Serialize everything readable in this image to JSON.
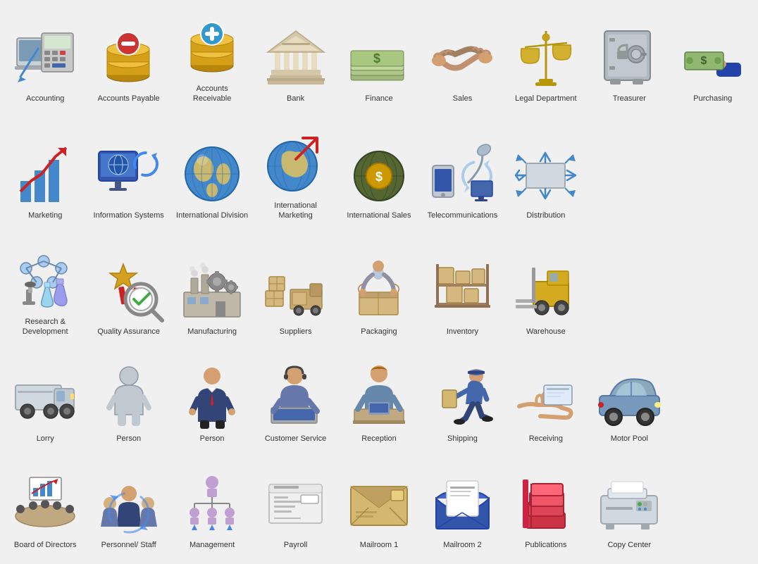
{
  "items": [
    {
      "id": "accounting",
      "label": "Accounting",
      "row": 1,
      "icon": "accounting"
    },
    {
      "id": "accounts-payable",
      "label": "Accounts Payable",
      "row": 1,
      "icon": "accounts-payable"
    },
    {
      "id": "accounts-receivable",
      "label": "Accounts Receivable",
      "row": 1,
      "icon": "accounts-receivable"
    },
    {
      "id": "bank",
      "label": "Bank",
      "row": 1,
      "icon": "bank"
    },
    {
      "id": "finance",
      "label": "Finance",
      "row": 1,
      "icon": "finance"
    },
    {
      "id": "sales",
      "label": "Sales",
      "row": 1,
      "icon": "sales"
    },
    {
      "id": "legal-department",
      "label": "Legal Department",
      "row": 1,
      "icon": "legal"
    },
    {
      "id": "treasurer",
      "label": "Treasurer",
      "row": 1,
      "icon": "treasurer"
    },
    {
      "id": "purchasing",
      "label": "Purchasing",
      "row": 1,
      "icon": "purchasing"
    },
    {
      "id": "marketing",
      "label": "Marketing",
      "row": 2,
      "icon": "marketing"
    },
    {
      "id": "information-systems",
      "label": "Information Systems",
      "row": 2,
      "icon": "info-systems"
    },
    {
      "id": "international-division",
      "label": "International Division",
      "row": 2,
      "icon": "intl-division"
    },
    {
      "id": "international-marketing",
      "label": "International Marketing",
      "row": 2,
      "icon": "intl-marketing"
    },
    {
      "id": "international-sales",
      "label": "International Sales",
      "row": 2,
      "icon": "intl-sales"
    },
    {
      "id": "telecommunications",
      "label": "Telecommunications",
      "row": 2,
      "icon": "telecom"
    },
    {
      "id": "distribution",
      "label": "Distribution",
      "row": 2,
      "icon": "distribution"
    },
    {
      "id": "research-development",
      "label": "Research & Development",
      "row": 3,
      "icon": "research"
    },
    {
      "id": "quality-assurance",
      "label": "Quality Assurance",
      "row": 3,
      "icon": "quality"
    },
    {
      "id": "manufacturing",
      "label": "Manufacturing",
      "row": 3,
      "icon": "manufacturing"
    },
    {
      "id": "suppliers",
      "label": "Suppliers",
      "row": 3,
      "icon": "suppliers"
    },
    {
      "id": "packaging",
      "label": "Packaging",
      "row": 3,
      "icon": "packaging"
    },
    {
      "id": "inventory",
      "label": "Inventory",
      "row": 3,
      "icon": "inventory"
    },
    {
      "id": "warehouse",
      "label": "Warehouse",
      "row": 3,
      "icon": "warehouse"
    },
    {
      "id": "lorry",
      "label": "Lorry",
      "row": 4,
      "icon": "lorry"
    },
    {
      "id": "person1",
      "label": "Person",
      "row": 4,
      "icon": "person-silhouette"
    },
    {
      "id": "person2",
      "label": "Person",
      "row": 4,
      "icon": "person-man"
    },
    {
      "id": "customer-service",
      "label": "Customer Service",
      "row": 4,
      "icon": "customer-service"
    },
    {
      "id": "reception",
      "label": "Reception",
      "row": 4,
      "icon": "reception"
    },
    {
      "id": "shipping",
      "label": "Shipping",
      "row": 4,
      "icon": "shipping"
    },
    {
      "id": "receiving",
      "label": "Receiving",
      "row": 4,
      "icon": "receiving"
    },
    {
      "id": "motor-pool",
      "label": "Motor Pool",
      "row": 4,
      "icon": "motor-pool"
    },
    {
      "id": "board-of-directors",
      "label": "Board of Directors",
      "row": 5,
      "icon": "board"
    },
    {
      "id": "personnel-staff",
      "label": "Personnel/ Staff",
      "row": 5,
      "icon": "personnel"
    },
    {
      "id": "management",
      "label": "Management",
      "row": 5,
      "icon": "management"
    },
    {
      "id": "payroll",
      "label": "Payroll",
      "row": 5,
      "icon": "payroll"
    },
    {
      "id": "mailroom1",
      "label": "Mailroom 1",
      "row": 5,
      "icon": "mailroom1"
    },
    {
      "id": "mailroom2",
      "label": "Mailroom 2",
      "row": 5,
      "icon": "mailroom2"
    },
    {
      "id": "publications",
      "label": "Publications",
      "row": 5,
      "icon": "publications"
    },
    {
      "id": "copy-center",
      "label": "Copy Center",
      "row": 5,
      "icon": "copy-center"
    }
  ]
}
